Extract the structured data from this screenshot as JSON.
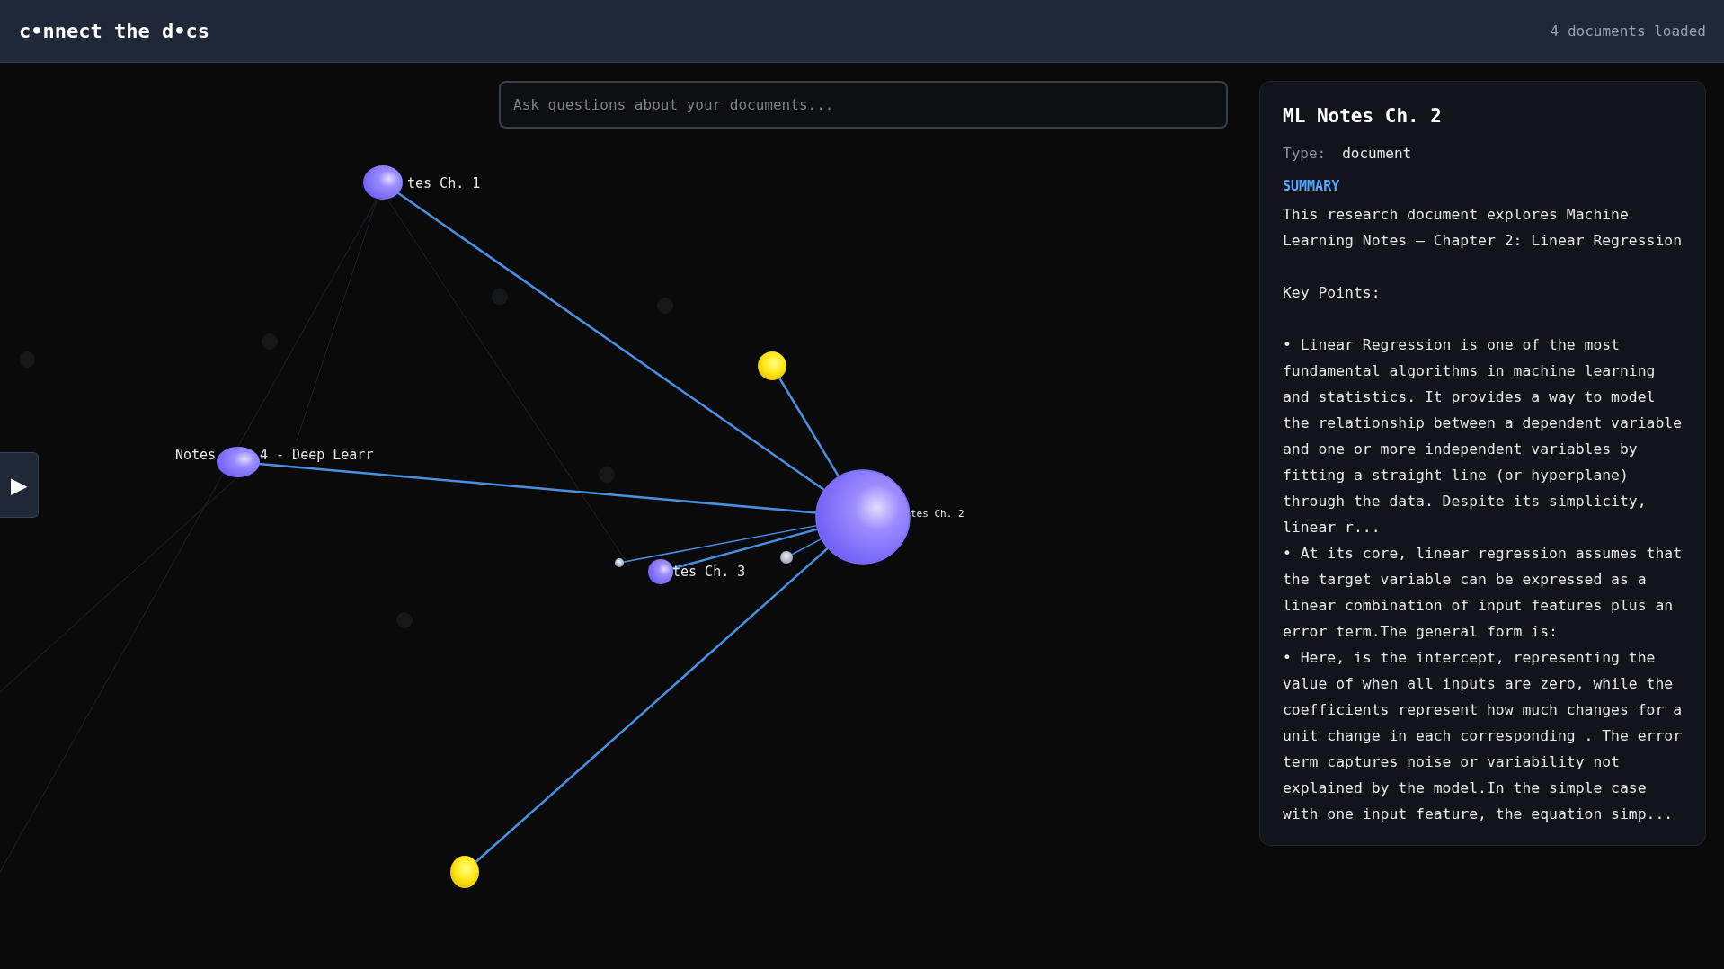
{
  "header": {
    "logo": "c•nnect the d•cs",
    "status": "4 documents loaded"
  },
  "search": {
    "placeholder": "Ask questions about your documents..."
  },
  "sidebar_toggle": {
    "icon": "▶"
  },
  "graph": {
    "nodes": [
      {
        "kind": "document",
        "selected": false,
        "labels": [
          "tes Ch. 1"
        ]
      },
      {
        "kind": "document",
        "selected": false,
        "labels": [
          "Notes",
          "4 - Deep Learr"
        ]
      },
      {
        "kind": "concept",
        "selected": false
      },
      {
        "kind": "document",
        "selected": true,
        "labels": [
          "tes Ch. 2"
        ]
      },
      {
        "kind": "chunk",
        "selected": false
      },
      {
        "kind": "document",
        "selected": false,
        "labels": [
          "tes Ch. 3"
        ]
      },
      {
        "kind": "chunk",
        "selected": false
      },
      {
        "kind": "concept",
        "selected": false
      }
    ]
  },
  "details": {
    "title": "ML Notes Ch. 2",
    "type_label": "Type:",
    "type_value": "document",
    "summary_heading": "SUMMARY",
    "intro": "This research document explores Machine Learning Notes – Chapter 2: Linear Regression",
    "key_points_heading": "Key Points:",
    "points": [
      "• Linear Regression is one of the most fundamental algorithms in machine learning and statistics. It provides a way to model the relationship between a dependent variable and one or more independent variables by fitting a straight line (or hyperplane) through the data. Despite its simplicity, linear r...",
      "• At its core, linear regression assumes that the target variable can be expressed as a linear combination of input features plus an error term.The general form is:",
      "• Here, is the intercept, representing the value of when all inputs are zero, while the coefficients represent how much changes for a unit change in each corresponding . The error term captures noise or variability not explained by the model.In the simple case with one input feature, the equation simp..."
    ]
  }
}
